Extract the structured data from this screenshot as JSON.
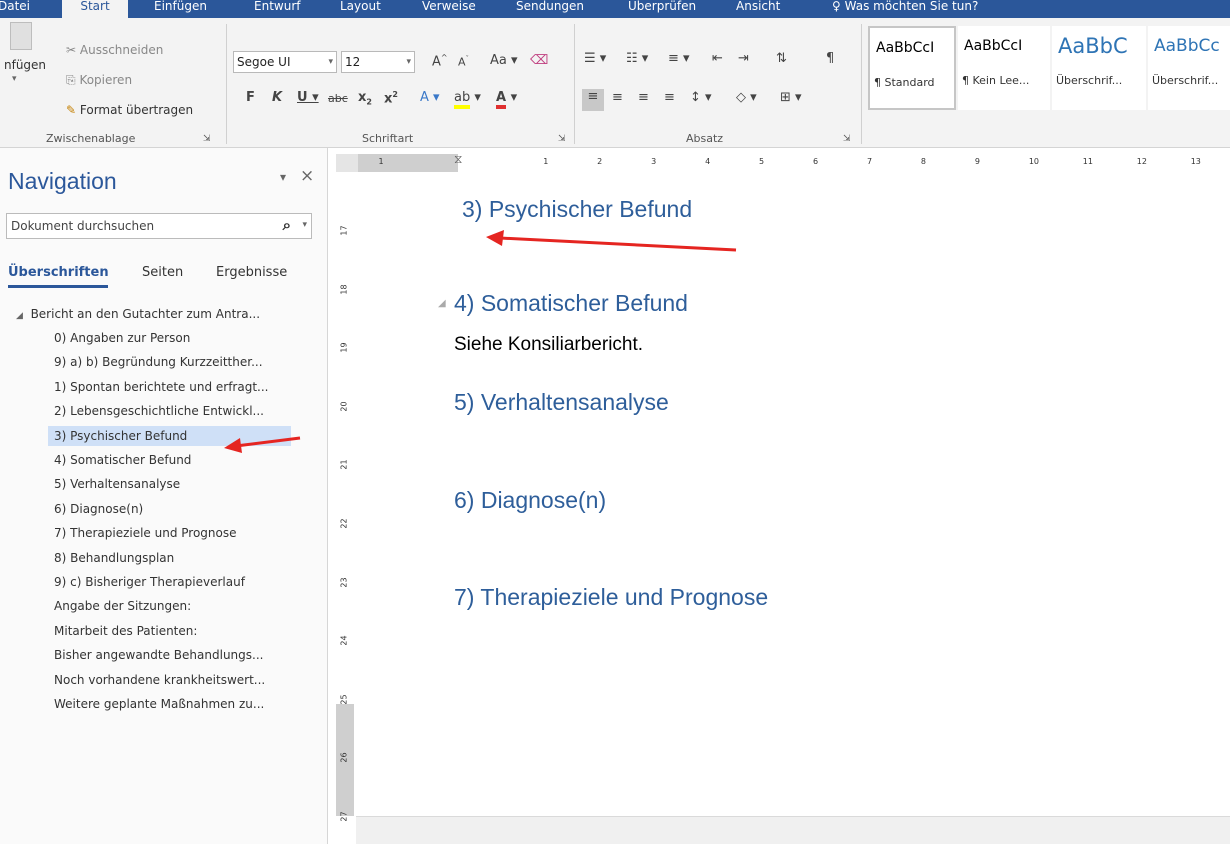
{
  "menu": [
    "Datei",
    "Start",
    "Einfügen",
    "Entwurf",
    "Layout",
    "Verweise",
    "Sendungen",
    "Überprüfen",
    "Ansicht"
  ],
  "tell_me": "Was möchten Sie tun?",
  "clipboard": {
    "paste_label": "nfügen",
    "cut": "Ausschneiden",
    "copy": "Kopieren",
    "format_painter": "Format übertragen",
    "group": "Zwischenablage"
  },
  "font": {
    "name": "Segoe UI",
    "size": "12",
    "group": "Schriftart"
  },
  "paragraph": {
    "group": "Absatz"
  },
  "styles": [
    {
      "sample": "AaBbCcI",
      "label": "¶ Standard"
    },
    {
      "sample": "AaBbCcI",
      "label": "¶ Kein Lee..."
    },
    {
      "sample": "AaBbC",
      "label": "Überschrif..."
    },
    {
      "sample": "AaBbCc",
      "label": "Überschrif..."
    }
  ],
  "navigation": {
    "title": "Navigation",
    "search_placeholder": "Dokument durchsuchen",
    "tabs": [
      "Überschriften",
      "Seiten",
      "Ergebnisse"
    ],
    "root": "Bericht an den Gutachter zum Antra...",
    "items": [
      "0) Angaben zur Person",
      "9) a) b) Begründung Kurzzeitther...",
      "1) Spontan berichtete und erfragt...",
      "2) Lebensgeschichtliche Entwickl...",
      "3) Psychischer Befund",
      "4) Somatischer Befund",
      "5) Verhaltensanalyse",
      "6) Diagnose(n)",
      "7) Therapieziele und Prognose",
      "8) Behandlungsplan",
      "9) c) Bisheriger Therapieverlauf",
      "Angabe der Sitzungen:",
      "Mitarbeit des Patienten:",
      "Bisher angewandte Behandlungs...",
      "Noch vorhandene krankheitswert...",
      "Weitere geplante Maßnahmen zu..."
    ],
    "selected_index": 4
  },
  "ruler": {
    "h": [
      "1",
      "1",
      "2",
      "3",
      "4",
      "5",
      "6",
      "7",
      "8",
      "9",
      "10",
      "11",
      "12",
      "13"
    ],
    "v": [
      "17",
      "18",
      "19",
      "20",
      "21",
      "22",
      "23",
      "24",
      "25",
      "26",
      "27"
    ]
  },
  "document": {
    "h3": "3)  Psychischer Befund",
    "h4": "4)  Somatischer Befund",
    "p4": "Siehe Konsiliarbericht.",
    "h5": "5)  Verhaltensanalyse",
    "h6": "6)  Diagnose(n)",
    "h7": "7)  Therapieziele und Prognose"
  },
  "colors": {
    "ribbon_blue": "#2b579a",
    "heading_blue": "#2e5e9a",
    "arrow_red": "#e52521",
    "selection": "#cfe0f7"
  }
}
